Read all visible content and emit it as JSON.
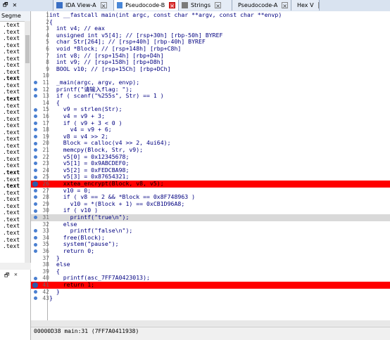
{
  "tabs": [
    {
      "label": "IDA View-A",
      "icon": "ida-view-icon",
      "active": false,
      "closable": false
    },
    {
      "label": "Pseudocode-B",
      "icon": "pseudocode-icon",
      "active": true,
      "closable": true
    },
    {
      "label": "Strings",
      "icon": "strings-icon",
      "active": false,
      "closable": false
    },
    {
      "label": "Pseudocode-A",
      "icon": "pseudocode-icon",
      "active": false,
      "closable": false
    },
    {
      "label": "Hex V",
      "icon": "hex-view-icon",
      "active": false,
      "closable": false
    }
  ],
  "segments": {
    "header": "Segme",
    "items": [
      ".text",
      ".text",
      ".text",
      ".text",
      ".text",
      ".text",
      ".text",
      ".text",
      ".text",
      ".text",
      ".text",
      ".text",
      ".text",
      ".text",
      ".text",
      ".text",
      ".text",
      ".text",
      ".text",
      ".text",
      ".text",
      ".text",
      ".text",
      ".text",
      ".text",
      ".text",
      ".text",
      ".text",
      ".text",
      ".text",
      ".text",
      ".text",
      ".text",
      ".text"
    ],
    "bold_indices": [
      8,
      11,
      22,
      24
    ]
  },
  "code_lines": [
    {
      "n": "1",
      "t": "int __fastcall main(int argc, const char **argv, const char **envp)"
    },
    {
      "n": "2",
      "t": "{"
    },
    {
      "n": "3",
      "t": "  int v4; // eax"
    },
    {
      "n": "4",
      "t": "  unsigned int v5[4]; // [rsp+30h] [rbp-50h] BYREF"
    },
    {
      "n": "5",
      "t": "  char Str[264]; // [rsp+40h] [rbp-40h] BYREF"
    },
    {
      "n": "6",
      "t": "  void *Block; // [rsp+148h] [rbp+C8h]"
    },
    {
      "n": "7",
      "t": "  int v8; // [rsp+154h] [rbp+D4h]"
    },
    {
      "n": "8",
      "t": "  int v9; // [rsp+158h] [rbp+D8h]"
    },
    {
      "n": "9",
      "t": "  BOOL v10; // [rsp+15Ch] [rbp+DCh]"
    },
    {
      "n": "10",
      "t": ""
    },
    {
      "n": "11",
      "t": "  _main(argc, argv, envp);"
    },
    {
      "n": "12",
      "t": "  printf(\"请输入flag: \");"
    },
    {
      "n": "13",
      "t": "  if ( scanf(\"%255s\", Str) == 1 )"
    },
    {
      "n": "14",
      "t": "  {"
    },
    {
      "n": "15",
      "t": "    v9 = strlen(Str);"
    },
    {
      "n": "16",
      "t": "    v4 = v9 + 3;"
    },
    {
      "n": "17",
      "t": "    if ( v9 + 3 < 0 )"
    },
    {
      "n": "18",
      "t": "      v4 = v9 + 6;"
    },
    {
      "n": "19",
      "t": "    v8 = v4 >> 2;"
    },
    {
      "n": "20",
      "t": "    Block = calloc(v4 >> 2, 4ui64);"
    },
    {
      "n": "21",
      "t": "    memcpy(Block, Str, v9);"
    },
    {
      "n": "22",
      "t": "    v5[0] = 0x12345678;"
    },
    {
      "n": "23",
      "t": "    v5[1] = 0x9ABCDEF0;"
    },
    {
      "n": "24",
      "t": "    v5[2] = 0xFEDCBA98;"
    },
    {
      "n": "25",
      "t": "    v5[3] = 0x87654321;"
    },
    {
      "n": "26",
      "t": "    xxtea_encrypt(Block, v8, v5);"
    },
    {
      "n": "27",
      "t": "    v10 = 0;"
    },
    {
      "n": "28",
      "t": "    if ( v8 == 2 && *Block == 0x8F748963 )"
    },
    {
      "n": "29",
      "t": "      v10 = *(Block + 1) == 0xCB1D96A8;"
    },
    {
      "n": "30",
      "t": "    if ( v10 )"
    },
    {
      "n": "31",
      "t": "      printf(\"true\\n\");"
    },
    {
      "n": "32",
      "t": "    else"
    },
    {
      "n": "33",
      "t": "      printf(\"false\\n\");"
    },
    {
      "n": "34",
      "t": "    free(Block);"
    },
    {
      "n": "35",
      "t": "    system(\"pause\");"
    },
    {
      "n": "36",
      "t": "    return 0;"
    },
    {
      "n": "37",
      "t": "  }"
    },
    {
      "n": "38",
      "t": "  else"
    },
    {
      "n": "39",
      "t": "  {"
    },
    {
      "n": "40",
      "t": "    printf(asc_7FF7A0423013);"
    },
    {
      "n": "41",
      "t": "    return 1;"
    },
    {
      "n": "42",
      "t": "  }"
    },
    {
      "n": "43",
      "t": "}"
    }
  ],
  "breakpoint_lines": [
    26,
    41
  ],
  "current_line": 31,
  "dotted_lines": [
    11,
    12,
    13,
    15,
    16,
    17,
    18,
    19,
    20,
    21,
    22,
    23,
    24,
    25,
    27,
    28,
    29,
    30,
    31,
    33,
    34,
    35,
    36,
    40,
    42,
    43
  ],
  "status": "00000D38 main:31 (7FF7A0411938)",
  "colors": {
    "breakpoint": "#ff0000",
    "current": "#d9d9d9",
    "comment": "#808080",
    "text": "#000080"
  }
}
